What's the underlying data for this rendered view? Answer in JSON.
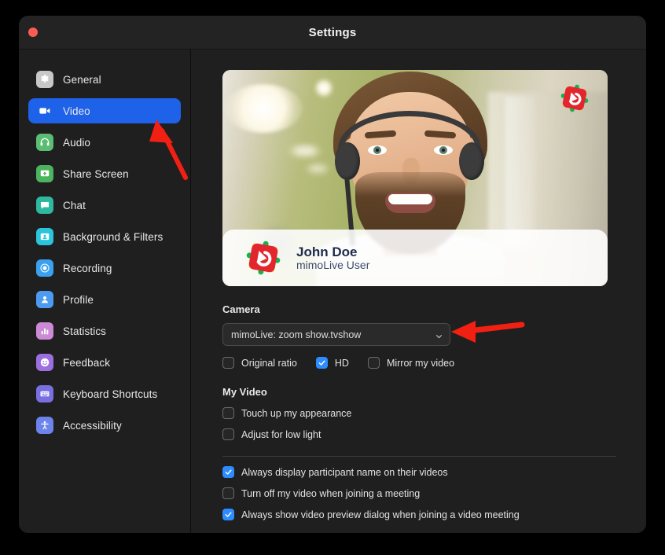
{
  "window": {
    "title": "Settings",
    "close_button": "close",
    "accent_blue": "#1f62ea",
    "checkbox_blue": "#2d8cff",
    "annotation_red": "#f22012"
  },
  "sidebar": {
    "items": [
      {
        "label": "General",
        "icon": "gear-icon",
        "icon_bg": "#c8c8c8",
        "active": false
      },
      {
        "label": "Video",
        "icon": "video-camera-icon",
        "icon_bg": "#1f62ea",
        "active": true
      },
      {
        "label": "Audio",
        "icon": "headphones-icon",
        "icon_bg": "#5bbd73",
        "active": false
      },
      {
        "label": "Share Screen",
        "icon": "share-screen-icon",
        "icon_bg": "#4cb45e",
        "active": false
      },
      {
        "label": "Chat",
        "icon": "chat-bubble-icon",
        "icon_bg": "#2fb8a0",
        "active": false
      },
      {
        "label": "Background & Filters",
        "icon": "background-filters-icon",
        "icon_bg": "#2bc5db",
        "active": false
      },
      {
        "label": "Recording",
        "icon": "record-icon",
        "icon_bg": "#3aa0ef",
        "active": false
      },
      {
        "label": "Profile",
        "icon": "person-icon",
        "icon_bg": "#4d9bf0",
        "active": false
      },
      {
        "label": "Statistics",
        "icon": "bar-chart-icon",
        "icon_bg": "#cc8ad6",
        "active": false
      },
      {
        "label": "Feedback",
        "icon": "smiley-icon",
        "icon_bg": "#9b6fe0",
        "active": false
      },
      {
        "label": "Keyboard Shortcuts",
        "icon": "keyboard-icon",
        "icon_bg": "#7a6fe0",
        "active": false
      },
      {
        "label": "Accessibility",
        "icon": "accessibility-icon",
        "icon_bg": "#6c83ea",
        "active": false
      }
    ]
  },
  "preview": {
    "name": "John Doe",
    "subtitle": "mimoLive User",
    "watermark_icon": "mimolive-logo-icon",
    "lower_third_logo": "mimolive-logo-icon"
  },
  "camera": {
    "section_title": "Camera",
    "selected_device": "mimoLive: zoom show.tvshow",
    "caret_icon": "chevron-down-icon",
    "options": [
      {
        "label": "Original ratio",
        "checked": false
      },
      {
        "label": "HD",
        "checked": true
      },
      {
        "label": "Mirror my video",
        "checked": false
      }
    ]
  },
  "my_video": {
    "section_title": "My Video",
    "options": [
      {
        "label": "Touch up my appearance",
        "checked": false
      },
      {
        "label": "Adjust for low light",
        "checked": false
      }
    ]
  },
  "meeting_options": [
    {
      "label": "Always display participant name on their videos",
      "checked": true
    },
    {
      "label": "Turn off my video when joining a meeting",
      "checked": false
    },
    {
      "label": "Always show video preview dialog when joining a video meeting",
      "checked": true
    }
  ],
  "annotations": [
    {
      "name": "arrow-pointing-to-video-tab",
      "target": "Video"
    },
    {
      "name": "arrow-pointing-to-camera-select",
      "target": "mimoLive: zoom show.tvshow"
    }
  ]
}
